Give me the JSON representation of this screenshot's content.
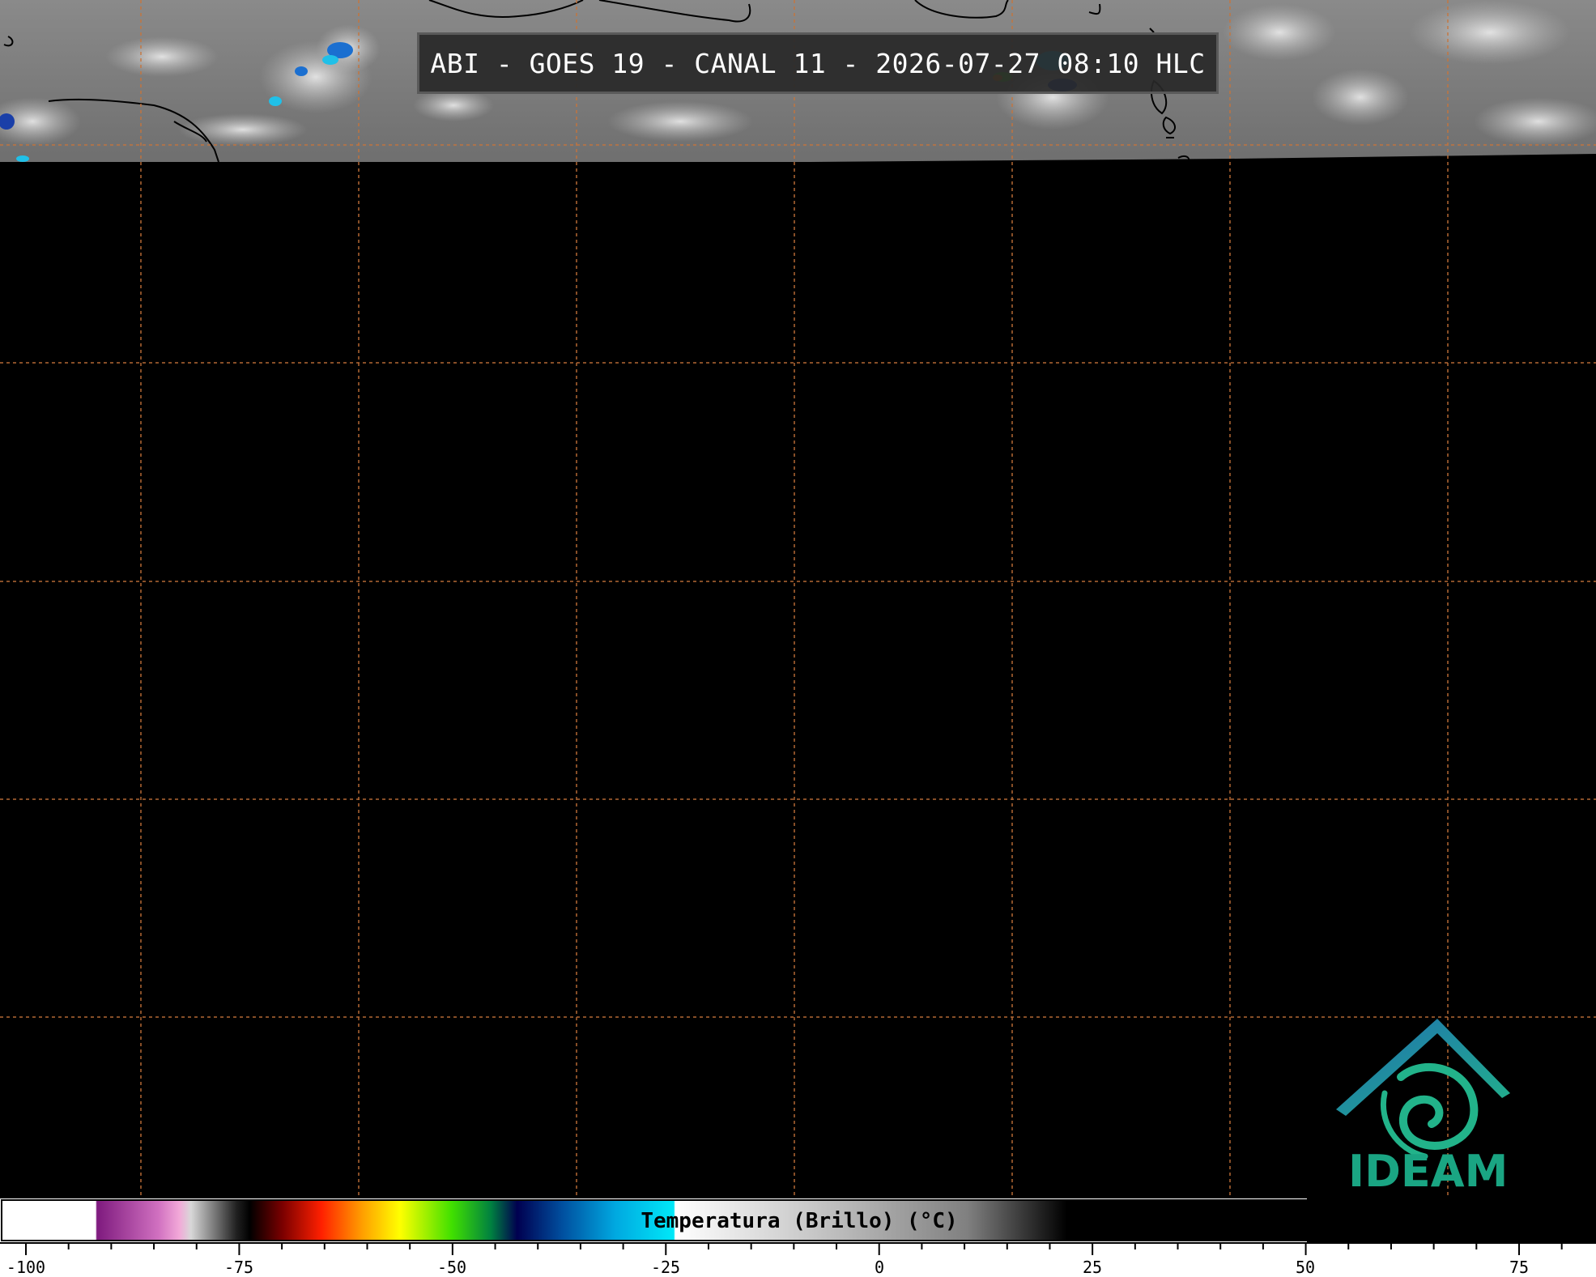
{
  "title": "ABI - GOES 19 - CANAL 11 - 2026-07-27 08:10 HLC",
  "colorbar": {
    "label": "Temperatura (Brillo) (°C)",
    "range": [
      -100,
      87
    ],
    "major_ticks": [
      "-100",
      "-75",
      "-50",
      "-25",
      "0",
      "25",
      "50",
      "75"
    ]
  },
  "logo": {
    "text": "IDEAM",
    "colors": {
      "text": "#1aa583",
      "roof_start": "#1f6fb0",
      "roof_end": "#22b38a"
    }
  },
  "map": {
    "grid_color": "#c8743a",
    "background": "#000000",
    "imagery_strip": "grayscale infrared cloud imagery along top edge with Caribbean coastlines"
  }
}
